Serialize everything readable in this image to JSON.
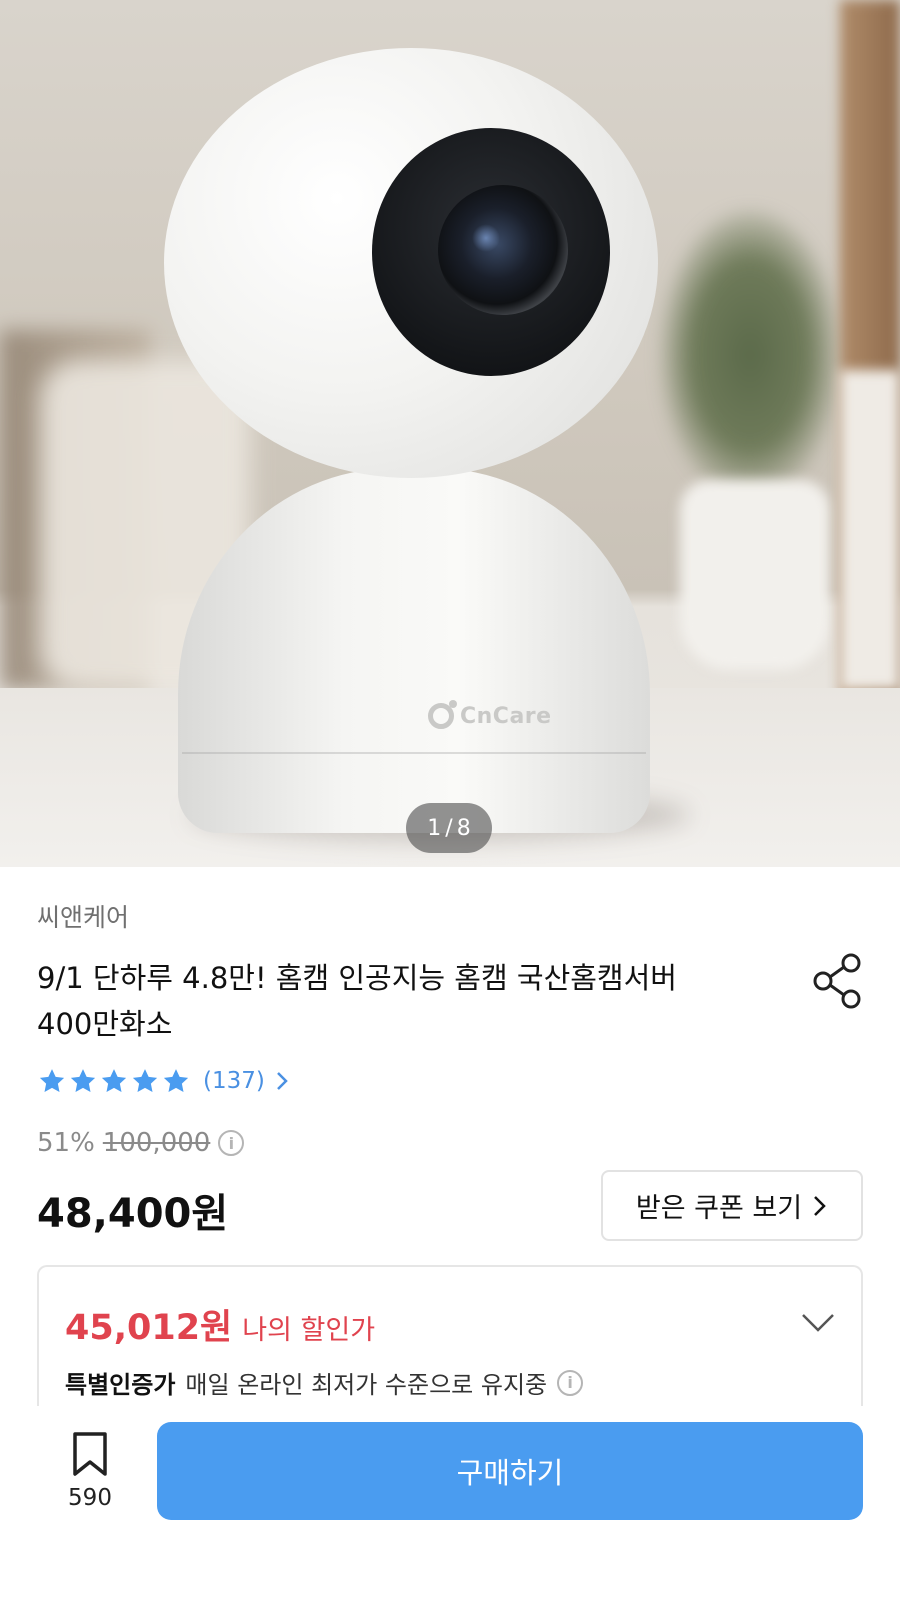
{
  "gallery": {
    "current": "1",
    "separator": "/",
    "total": "8",
    "product_brand_mark": "CnCare"
  },
  "product": {
    "brand": "씨앤케어",
    "title": "9/1 단하루 4.8만! 홈캠 인공지능 홈캠 국산홈캠서버 400만화소",
    "rating": {
      "stars": 5,
      "review_count": "(137)"
    },
    "discount_rate": "51%",
    "original_price": "100,000",
    "price": "48,400원"
  },
  "coupon": {
    "label": "받은 쿠폰 보기"
  },
  "my_discount": {
    "price": "45,012원",
    "label": "나의 할인가",
    "special_title": "특별인증가",
    "special_desc": "매일 온라인 최저가 수준으로 유지중"
  },
  "bottom_bar": {
    "bookmark_count": "590",
    "buy_label": "구매하기"
  },
  "icons": {
    "share": "share-icon",
    "star": "star-icon",
    "chevron_right": "chevron-right-icon",
    "chevron_down": "chevron-down-icon",
    "info": "info-icon",
    "bookmark": "bookmark-icon"
  },
  "colors": {
    "accent_blue": "#4a9cf0",
    "link_blue": "#4a90e2",
    "discount_red": "#e0434e",
    "muted_gray": "#8a8a8a"
  }
}
